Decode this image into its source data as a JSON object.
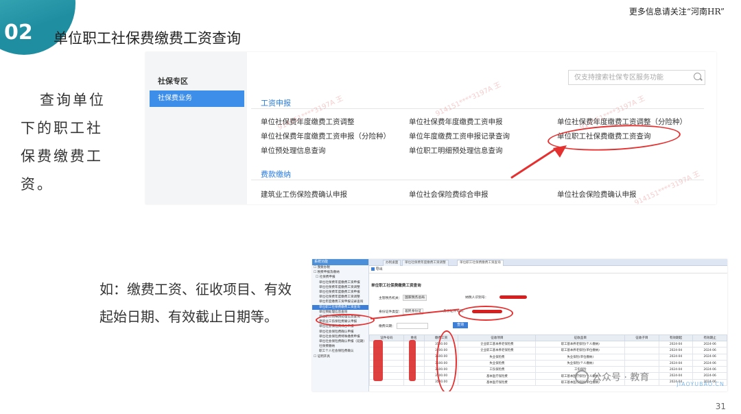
{
  "header": {
    "section_number": "02",
    "title": "单位职工社保费缴费工资查询",
    "top_note": "更多信息请关注“河南HR”"
  },
  "left_text": "查询单位下的职工社保费缴费工资。",
  "bottom_text": "如：缴费工资、征收项目、有效起始日期、有效截止日期等。",
  "page_number": "31",
  "screenshot1": {
    "sidebar_title": "社保专区",
    "sidebar_item": "社保费业务",
    "search_placeholder": "仅支持搜索社保专区服务功能",
    "section1": "工资申报",
    "section2": "费款缴纳",
    "links": [
      "单位社保费年度缴费工资调整",
      "单位社保费年度缴费工资申报",
      "单位社保费年度缴费工资调整（分险种）",
      "单位社保费年度缴费工资申报（分险种）",
      "单位年度缴费工资申报记录查询",
      "单位职工社保费缴费工资查询",
      "单位预处理信息查询",
      "单位职工明细预处理信息查询"
    ],
    "fee_links": [
      "建筑业工伤保险费确认申报",
      "单位社会保险费综合申报",
      "单位社会保险费确认申报"
    ],
    "watermark": "914151****3197A 王"
  },
  "screenshot2": {
    "tree_head": "系统功能",
    "tree_items": [
      "☐ 我要办税",
      "☐ 税费申报及缴纳",
      "☐ 社保费申报",
      "单位社保费年度缴费工资申报",
      "单位社保费年度缴费工资调整",
      "单位社保费年度缴费工资申报",
      "单位社保费年度缴费工资调整",
      "单位年度缴费工资申报记录查询",
      "单位职工社保费缴费工资查询",
      "单位预处理信息查询",
      "单位职工明细预处理信息查询",
      "建筑业工伤保险费确认申报",
      "单位社会保险费综合申报",
      "单位社会保险费确认申报",
      "单位社会保险费特殊缴费申报",
      "单位社会保险费确认申报（延期）",
      "社保费缴纳",
      "职工个人社会保险费确认",
      "☐ 证明开具"
    ],
    "tabs": [
      "办税桌面",
      "单位社保费年度缴费工资调整",
      "单位职工社保费缴费工资查询"
    ],
    "toolbar": "导出",
    "page_title": "单位职工社保费缴费工资查询",
    "label_authority": "主管税务机关：",
    "authority_value": "国家税务总局",
    "label_taxpayer": "纳税人识别号：",
    "label_idtype": "身份证件类型：",
    "idtype_value": "居民身份证",
    "label_idnum": "身份证件号码：",
    "label_date": "缴费日期：",
    "query_button": "查询",
    "table_headers": [
      "证件号码",
      "姓名",
      "缴费工资",
      "征收项目",
      "征收品目",
      "征收子目",
      "有效期起",
      "有效期止"
    ],
    "rows": [
      [
        "",
        "",
        "3500.00",
        "企业职工基本养老保险费",
        "职工基本养老保险(个人缴纳)",
        "",
        "2024-04",
        "2024-06"
      ],
      [
        "",
        "",
        "3500.00",
        "企业职工基本养老保险费",
        "职工基本养老保险(单位缴纳)",
        "",
        "2024-04",
        "2024-06"
      ],
      [
        "",
        "",
        "3500.00",
        "失业保险费",
        "失业保险(单位缴纳)",
        "",
        "2024-04",
        "2024-06"
      ],
      [
        "",
        "",
        "3500.00",
        "失业保险费",
        "失业保险(个人缴纳)",
        "",
        "2024-04",
        "2024-06"
      ],
      [
        "",
        "",
        "3500.00",
        "工伤保险费",
        "工伤保险",
        "",
        "2024-04",
        "2024-06"
      ],
      [
        "",
        "",
        "3500.00",
        "基本医疗保险费",
        "职工基本医疗保险(个人缴纳)",
        "",
        "2024-04",
        "2024-06"
      ],
      [
        "",
        "",
        "3500.00",
        "基本医疗保险费",
        "职工基本医疗保险(单位缴纳)",
        "",
        "2024-04",
        "2024-06"
      ]
    ],
    "gzh_text": "公众号 · 教育",
    "brand_sub": "JIAOYUBAO.CN"
  }
}
